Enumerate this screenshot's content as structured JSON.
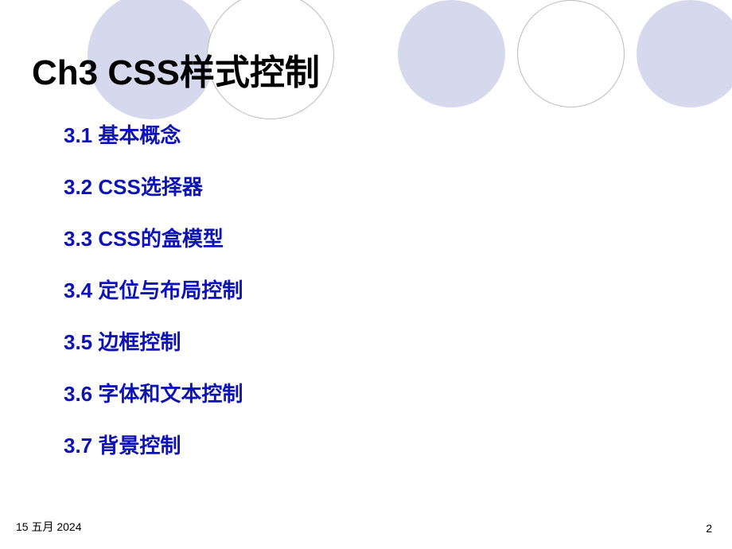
{
  "title": "Ch3  CSS样式控制",
  "toc": [
    "3.1  基本概念",
    "3.2  CSS选择器",
    "3.3  CSS的盒模型",
    "3.4  定位与布局控制",
    "3.5  边框控制",
    "3.6  字体和文本控制",
    "3.7  背景控制"
  ],
  "footer": {
    "date": "15 五月 2024",
    "page": "2"
  },
  "colors": {
    "toc_text": "#0d13b5",
    "circle_fill": "#d6d9ee"
  }
}
